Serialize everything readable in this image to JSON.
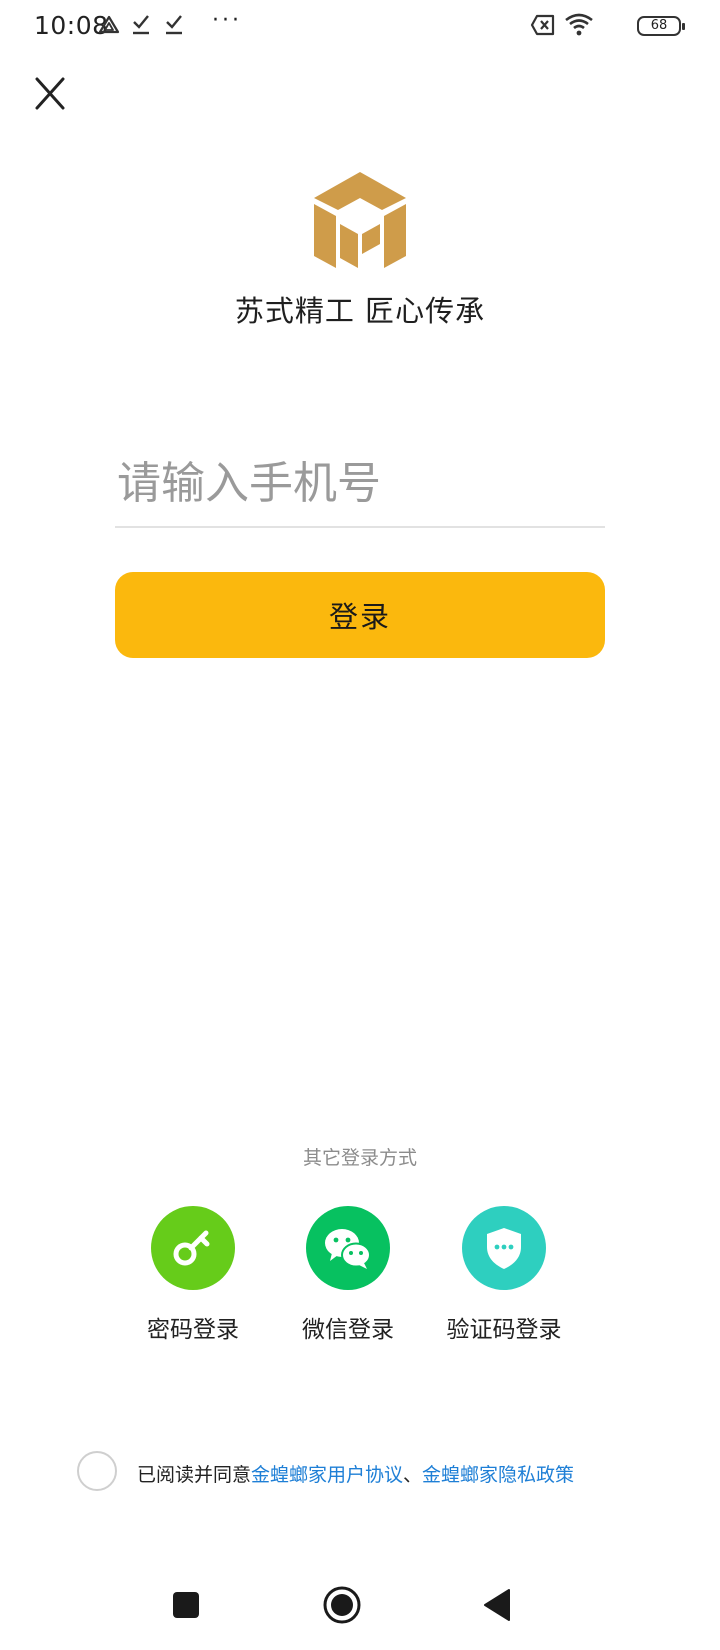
{
  "status_bar": {
    "time": "10:08",
    "battery_level": "68",
    "more_glyph": "···",
    "icons": [
      "drive-icon",
      "download-done-icon",
      "download-done-icon",
      "sim-off-icon",
      "wifi-icon",
      "battery-icon"
    ]
  },
  "header": {
    "close_icon": "close-icon"
  },
  "brand": {
    "logo": "kingdee-home-logo",
    "logo_color": "#cf9c4a",
    "slogan": "苏式精工 匠心传承"
  },
  "login_form": {
    "phone_placeholder": "请输入手机号",
    "phone_value": "",
    "login_label": "登录",
    "login_color": "#fbb80d"
  },
  "other_methods": {
    "title": "其它登录方式",
    "items": [
      {
        "label": "密码登录",
        "icon": "key-icon",
        "color": "#66cc1a"
      },
      {
        "label": "微信登录",
        "icon": "wechat-icon",
        "color": "#07c160"
      },
      {
        "label": "验证码登录",
        "icon": "shield-icon",
        "color": "#2ecfbf"
      }
    ]
  },
  "agreement": {
    "prefix": "已阅读并同意",
    "user_agreement": "金蝗螂家用户协议",
    "separator": "、",
    "privacy_policy": "金蝗螂家隐私政策",
    "link_color": "#1e7fd6"
  },
  "nav_bar": {
    "buttons": [
      "recents-icon",
      "home-icon",
      "back-icon"
    ]
  }
}
